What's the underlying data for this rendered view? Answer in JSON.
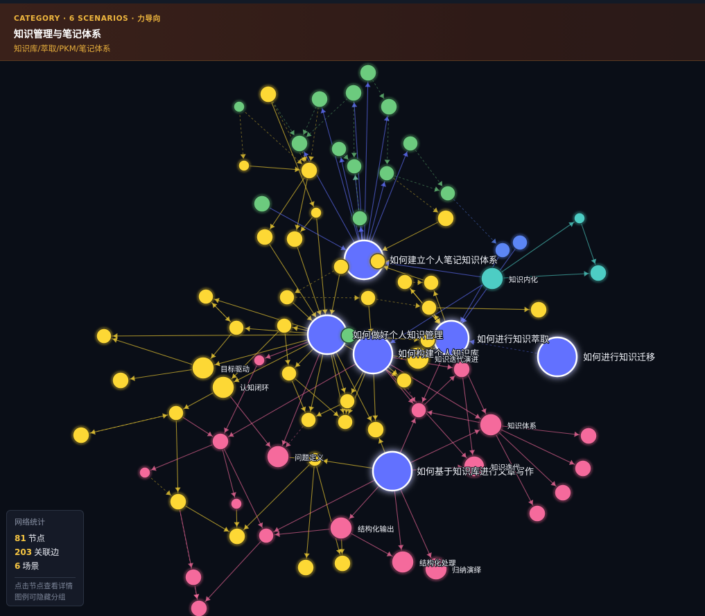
{
  "header": {
    "category": "CATEGORY · 6 SCENARIOS · 力导向",
    "title": "知识管理与笔记体系",
    "subtitle": "知识库/萃取/PKM/笔记体系"
  },
  "colors": {
    "scenario": "#6271ff",
    "yellow": "#fdd835",
    "green": "#6ccb7e",
    "pink": "#f56b9c",
    "teal": "#4ecdc4",
    "blue": "#5b86f5",
    "background": "#0a0e17",
    "accent": "#f0b73e"
  },
  "nodes": [
    {
      "id": "s1",
      "group": "scenario",
      "label": "如何建立个人笔记知识体系"
    },
    {
      "id": "s2",
      "group": "scenario",
      "label": "如何做好个人知识管理"
    },
    {
      "id": "s3",
      "group": "scenario",
      "label": "如何构建个人知识库"
    },
    {
      "id": "s4",
      "group": "scenario",
      "label": "如何进行知识萃取"
    },
    {
      "id": "s5",
      "group": "scenario",
      "label": "如何进行知识迁移"
    },
    {
      "id": "s6",
      "group": "scenario",
      "label": "如何基于知识库进行文章写作"
    },
    {
      "id": "k1",
      "group": "teal",
      "label": "知识内化"
    },
    {
      "id": "k2",
      "group": "pink",
      "label": "知识体系"
    },
    {
      "id": "k3",
      "group": "pink",
      "label": "问题定义"
    },
    {
      "id": "k4",
      "group": "yellow",
      "label": "目标驱动"
    },
    {
      "id": "k5",
      "group": "yellow",
      "label": "认知闭环"
    },
    {
      "id": "k6",
      "group": "pink",
      "label": "结构化输出"
    },
    {
      "id": "k7",
      "group": "pink",
      "label": "结构化处理"
    },
    {
      "id": "k8",
      "group": "pink",
      "label": "归纳演绎"
    },
    {
      "id": "k9",
      "group": "pink",
      "label": "知识迭代"
    },
    {
      "id": "k10",
      "group": "yellow",
      "label": "知识迭代演进"
    }
  ],
  "stats": {
    "title": "网络统计",
    "nodes_count": "81",
    "nodes_label": "节点",
    "edges_count": "203",
    "edges_label": "关联边",
    "scenarios_count": "6",
    "scenarios_label": "场景",
    "hint1": "点击节点查看详情",
    "hint2": "图例可隐藏分组"
  }
}
